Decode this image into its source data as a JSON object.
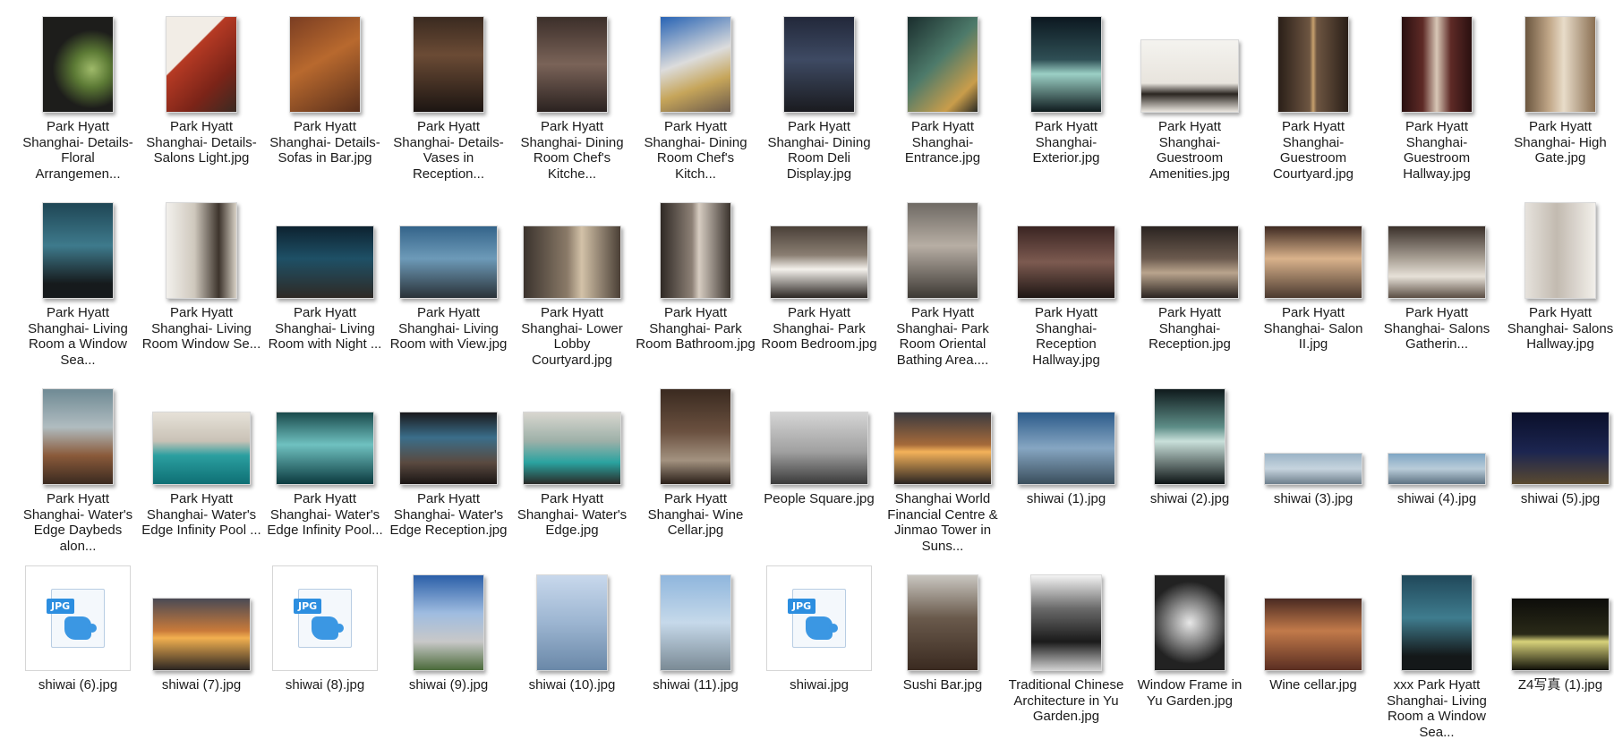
{
  "files": [
    {
      "label": "Park Hyatt Shanghai- Details- Floral Arrangemen...",
      "thumb": "floral",
      "shape": "portrait"
    },
    {
      "label": "Park Hyatt Shanghai- Details- Salons Light.jpg",
      "thumb": "red",
      "shape": "portrait"
    },
    {
      "label": "Park Hyatt Shanghai- Details- Sofas in Bar.jpg",
      "thumb": "bar",
      "shape": "portrait"
    },
    {
      "label": "Park Hyatt Shanghai- Details- Vases in Reception...",
      "thumb": "vases",
      "shape": "portrait"
    },
    {
      "label": "Park Hyatt Shanghai- Dining Room Chef's Kitche...",
      "thumb": "dining",
      "shape": "portrait"
    },
    {
      "label": "Park Hyatt Shanghai- Dining Room Chef's Kitch...",
      "thumb": "chef",
      "shape": "portrait"
    },
    {
      "label": "Park Hyatt Shanghai- Dining Room Deli Display.jpg",
      "thumb": "deli",
      "shape": "portrait"
    },
    {
      "label": "Park Hyatt Shanghai- Entrance.jpg",
      "thumb": "entrance",
      "shape": "portrait"
    },
    {
      "label": "Park Hyatt Shanghai- Exterior.jpg",
      "thumb": "exterior",
      "shape": "portrait"
    },
    {
      "label": "Park Hyatt Shanghai- Guestroom Amenities.jpg",
      "thumb": "amen",
      "shape": "landscape"
    },
    {
      "label": "Park Hyatt Shanghai- Guestroom Courtyard.jpg",
      "thumb": "court",
      "shape": "portrait"
    },
    {
      "label": "Park Hyatt Shanghai- Guestroom Hallway.jpg",
      "thumb": "hall",
      "shape": "portrait"
    },
    {
      "label": "Park Hyatt Shanghai- High Gate.jpg",
      "thumb": "high",
      "shape": "portrait"
    },
    {
      "label": "Park Hyatt Shanghai- Living Room a Window Sea...",
      "thumb": "window",
      "shape": "portrait"
    },
    {
      "label": "Park Hyatt Shanghai- Living Room Window Se...",
      "thumb": "salon",
      "shape": "portrait"
    },
    {
      "label": "Park Hyatt Shanghai- Living Room with Night ...",
      "thumb": "night",
      "shape": "landscape"
    },
    {
      "label": "Park Hyatt Shanghai- Living Room with View.jpg",
      "thumb": "view",
      "shape": "landscape"
    },
    {
      "label": "Park Hyatt Shanghai- Lower Lobby Courtyard.jpg",
      "thumb": "lobby",
      "shape": "landscape"
    },
    {
      "label": "Park Hyatt Shanghai- Park Room Bathroom.jpg",
      "thumb": "bath",
      "shape": "portrait"
    },
    {
      "label": "Park Hyatt Shanghai- Park Room Bedroom.jpg",
      "thumb": "bed",
      "shape": "landscape"
    },
    {
      "label": "Park Hyatt Shanghai- Park Room Oriental Bathing Area....",
      "thumb": "orient",
      "shape": "portrait"
    },
    {
      "label": "Park Hyatt Shanghai- Reception Hallway.jpg",
      "thumb": "recep",
      "shape": "landscape"
    },
    {
      "label": "Park Hyatt Shanghai- Reception.jpg",
      "thumb": "recep2",
      "shape": "landscape"
    },
    {
      "label": "Park Hyatt Shanghai- Salon II.jpg",
      "thumb": "salon2",
      "shape": "landscape"
    },
    {
      "label": "Park Hyatt Shanghai- Salons Gatherin...",
      "thumb": "gather",
      "shape": "landscape"
    },
    {
      "label": "Park Hyatt Shanghai- Salons Hallway.jpg",
      "thumb": "shall",
      "shape": "portrait"
    },
    {
      "label": "Park Hyatt Shanghai- Water's Edge Daybeds alon...",
      "thumb": "daybed",
      "shape": "portrait"
    },
    {
      "label": "Park Hyatt Shanghai- Water's Edge Infinity Pool ...",
      "thumb": "pool",
      "shape": "landscape"
    },
    {
      "label": "Park Hyatt Shanghai- Water's Edge Infinity Pool...",
      "thumb": "pool2",
      "shape": "landscape"
    },
    {
      "label": "Park Hyatt Shanghai- Water's Edge Reception.jpg",
      "thumb": "wrecep",
      "shape": "landscape"
    },
    {
      "label": "Park Hyatt Shanghai- Water's Edge.jpg",
      "thumb": "wedge",
      "shape": "landscape"
    },
    {
      "label": "Park Hyatt Shanghai- Wine Cellar.jpg",
      "thumb": "wine",
      "shape": "portrait"
    },
    {
      "label": "People Square.jpg",
      "thumb": "people",
      "shape": "landscape"
    },
    {
      "label": "Shanghai World Financial Centre & Jinmao Tower in Suns...",
      "thumb": "sunset",
      "shape": "landscape"
    },
    {
      "label": "shiwai (1).jpg",
      "thumb": "sky1",
      "shape": "landscape"
    },
    {
      "label": "shiwai (2).jpg",
      "thumb": "spire",
      "shape": "portrait"
    },
    {
      "label": "shiwai (3).jpg",
      "thumb": "pano1",
      "shape": "pano"
    },
    {
      "label": "shiwai (4).jpg",
      "thumb": "pano2",
      "shape": "pano"
    },
    {
      "label": "shiwai (5).jpg",
      "thumb": "nightcity",
      "shape": "landscape"
    },
    {
      "label": "shiwai (6).jpg",
      "thumb": "jpg",
      "shape": "icon"
    },
    {
      "label": "shiwai (7).jpg",
      "thumb": "sunset2",
      "shape": "landscape"
    },
    {
      "label": "shiwai (8).jpg",
      "thumb": "jpg",
      "shape": "icon"
    },
    {
      "label": "shiwai (9).jpg",
      "thumb": "tower",
      "shape": "portrait"
    },
    {
      "label": "shiwai (10).jpg",
      "thumb": "tower2",
      "shape": "portrait"
    },
    {
      "label": "shiwai (11).jpg",
      "thumb": "sky2",
      "shape": "portrait"
    },
    {
      "label": "shiwai.jpg",
      "thumb": "jpg",
      "shape": "icon"
    },
    {
      "label": "Sushi Bar.jpg",
      "thumb": "sushi",
      "shape": "portrait"
    },
    {
      "label": "Traditional Chinese Architecture in Yu Garden.jpg",
      "thumb": "trad",
      "shape": "portrait"
    },
    {
      "label": "Window Frame in Yu Garden.jpg",
      "thumb": "frame",
      "shape": "portrait"
    },
    {
      "label": "Wine cellar.jpg",
      "thumb": "cellar",
      "shape": "landscape"
    },
    {
      "label": "xxx Park Hyatt Shanghai- Living Room a Window Sea...",
      "thumb": "xxx",
      "shape": "portrait"
    },
    {
      "label": "Z4写真 (1).jpg",
      "thumb": "z4",
      "shape": "landscape"
    }
  ],
  "placeholder_icon_text": "JPG"
}
